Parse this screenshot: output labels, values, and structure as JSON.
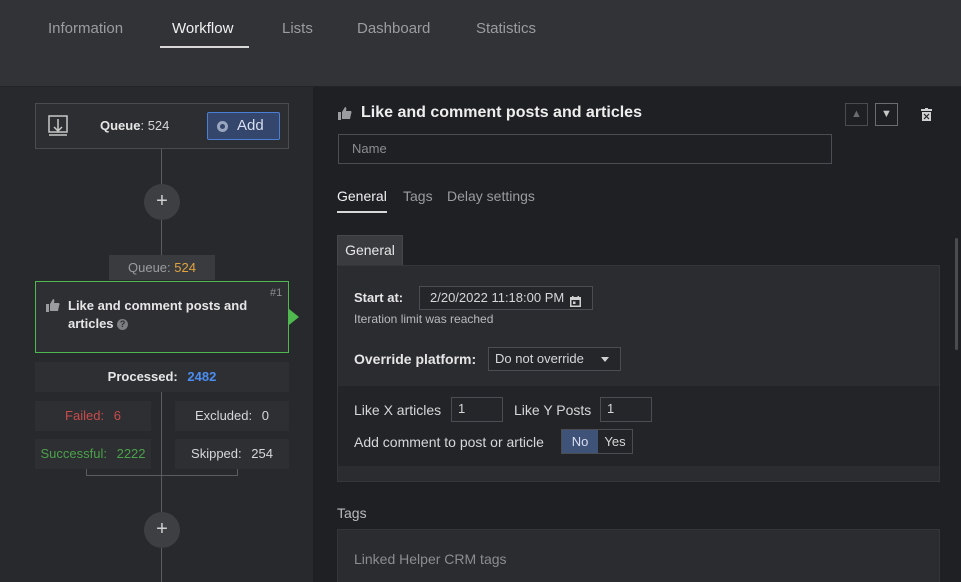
{
  "top_tabs": [
    "Information",
    "Workflow",
    "Lists",
    "Dashboard",
    "Statistics"
  ],
  "workflow": {
    "queue_label": "Queue",
    "queue_count": "524",
    "add_label": "Add",
    "node_queue_label": "Queue:",
    "node_queue_count": "524",
    "node_number": "#1",
    "node_title": "Like and comment posts and articles",
    "processed_label": "Processed:",
    "processed_value": "2482",
    "failed_label": "Failed:",
    "failed_value": "6",
    "excluded_label": "Excluded:",
    "excluded_value": "0",
    "successful_label": "Successful:",
    "successful_value": "2222",
    "skipped_label": "Skipped:",
    "skipped_value": "254",
    "plus_symbol": "+"
  },
  "panel": {
    "title": "Like and comment posts and articles",
    "name_placeholder": "Name",
    "subtabs": [
      "General",
      "Tags",
      "Delay settings"
    ],
    "general_tab": "General",
    "start_at_label": "Start at:",
    "start_at_value": "2/20/2022 11:18:00 PM",
    "iteration_note": "Iteration limit was reached",
    "override_label": "Override platform:",
    "override_value": "Do not override",
    "like_articles_label": "Like X articles",
    "like_articles_value": "1",
    "like_posts_label": "Like Y Posts",
    "like_posts_value": "1",
    "add_comment_label": "Add comment to post or article",
    "toggle_no": "No",
    "toggle_yes": "Yes",
    "tags_heading": "Tags",
    "crm_tags_placeholder": "Linked Helper CRM tags"
  },
  "colors": {
    "accent_blue": "#4b8df0",
    "failed_red": "#c84b4b",
    "success_green": "#4aa24a",
    "queue_orange": "#e0a33e",
    "node_border": "#4fb84f"
  },
  "icons": [
    "import-icon",
    "add-circle-icon",
    "plus-icon",
    "thumbs-up-icon",
    "help-icon",
    "chevron-up-icon",
    "chevron-down-icon",
    "trash-icon",
    "calendar-icon",
    "dropdown-arrow-icon"
  ]
}
